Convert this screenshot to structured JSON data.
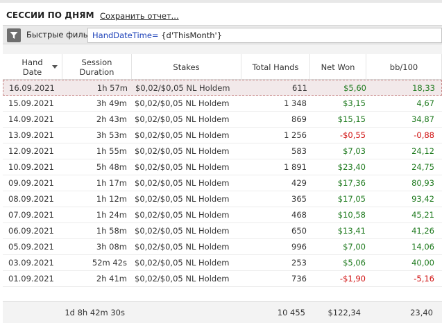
{
  "title": "СЕССИИ ПО ДНЯМ",
  "save_report": "Сохранить отчет...",
  "filter": {
    "label": "Быстрые фильтры",
    "key": "HandDateTime=",
    "value": " {d'ThisMonth'}"
  },
  "columns": [
    {
      "name": "hand-date",
      "label_lines": [
        "Hand",
        "Date"
      ]
    },
    {
      "name": "session-duration",
      "label_lines": [
        "Session",
        "Duration"
      ]
    },
    {
      "name": "stakes",
      "label_lines": [
        "Stakes"
      ]
    },
    {
      "name": "total-hands",
      "label_lines": [
        "Total Hands"
      ]
    },
    {
      "name": "net-won",
      "label_lines": [
        "Net Won"
      ]
    },
    {
      "name": "bb-100",
      "label_lines": [
        "bb/100"
      ]
    }
  ],
  "rows": [
    {
      "date": "16.09.2021",
      "duration": "1h 57m",
      "stakes": "$0,02/$0,05 NL Holdem",
      "hands": "611",
      "won": "$5,60",
      "bb": "18,33",
      "sign": "pos",
      "selected": true
    },
    {
      "date": "15.09.2021",
      "duration": "3h 49m",
      "stakes": "$0,02/$0,05 NL Holdem",
      "hands": "1 348",
      "won": "$3,15",
      "bb": "4,67",
      "sign": "pos",
      "selected": false
    },
    {
      "date": "14.09.2021",
      "duration": "2h 43m",
      "stakes": "$0,02/$0,05 NL Holdem",
      "hands": "869",
      "won": "$15,15",
      "bb": "34,87",
      "sign": "pos",
      "selected": false
    },
    {
      "date": "13.09.2021",
      "duration": "3h 53m",
      "stakes": "$0,02/$0,05 NL Holdem",
      "hands": "1 256",
      "won": "-$0,55",
      "bb": "-0,88",
      "sign": "neg",
      "selected": false
    },
    {
      "date": "12.09.2021",
      "duration": "1h 55m",
      "stakes": "$0,02/$0,05 NL Holdem",
      "hands": "583",
      "won": "$7,03",
      "bb": "24,12",
      "sign": "pos",
      "selected": false
    },
    {
      "date": "10.09.2021",
      "duration": "5h 48m",
      "stakes": "$0,02/$0,05 NL Holdem",
      "hands": "1 891",
      "won": "$23,40",
      "bb": "24,75",
      "sign": "pos",
      "selected": false
    },
    {
      "date": "09.09.2021",
      "duration": "1h 17m",
      "stakes": "$0,02/$0,05 NL Holdem",
      "hands": "429",
      "won": "$17,36",
      "bb": "80,93",
      "sign": "pos",
      "selected": false
    },
    {
      "date": "08.09.2021",
      "duration": "1h 12m",
      "stakes": "$0,02/$0,05 NL Holdem",
      "hands": "365",
      "won": "$17,05",
      "bb": "93,42",
      "sign": "pos",
      "selected": false
    },
    {
      "date": "07.09.2021",
      "duration": "1h 24m",
      "stakes": "$0,02/$0,05 NL Holdem",
      "hands": "468",
      "won": "$10,58",
      "bb": "45,21",
      "sign": "pos",
      "selected": false
    },
    {
      "date": "06.09.2021",
      "duration": "1h 58m",
      "stakes": "$0,02/$0,05 NL Holdem",
      "hands": "650",
      "won": "$13,41",
      "bb": "41,26",
      "sign": "pos",
      "selected": false
    },
    {
      "date": "05.09.2021",
      "duration": "3h 08m",
      "stakes": "$0,02/$0,05 NL Holdem",
      "hands": "996",
      "won": "$7,00",
      "bb": "14,06",
      "sign": "pos",
      "selected": false
    },
    {
      "date": "03.09.2021",
      "duration": "52m 42s",
      "stakes": "$0,02/$0,05 NL Holdem",
      "hands": "253",
      "won": "$5,06",
      "bb": "40,00",
      "sign": "pos",
      "selected": false
    },
    {
      "date": "01.09.2021",
      "duration": "2h 41m",
      "stakes": "$0,02/$0,05 NL Holdem",
      "hands": "736",
      "won": "-$1,90",
      "bb": "-5,16",
      "sign": "neg",
      "selected": false
    }
  ],
  "totals": {
    "duration": "1d 8h 42m 30s",
    "hands": "10 455",
    "won": "$122,34",
    "bb": "23,40"
  },
  "colors": {
    "positive": "#1e7a1e",
    "negative": "#d01010",
    "selected_row": "#f2e9ea"
  }
}
